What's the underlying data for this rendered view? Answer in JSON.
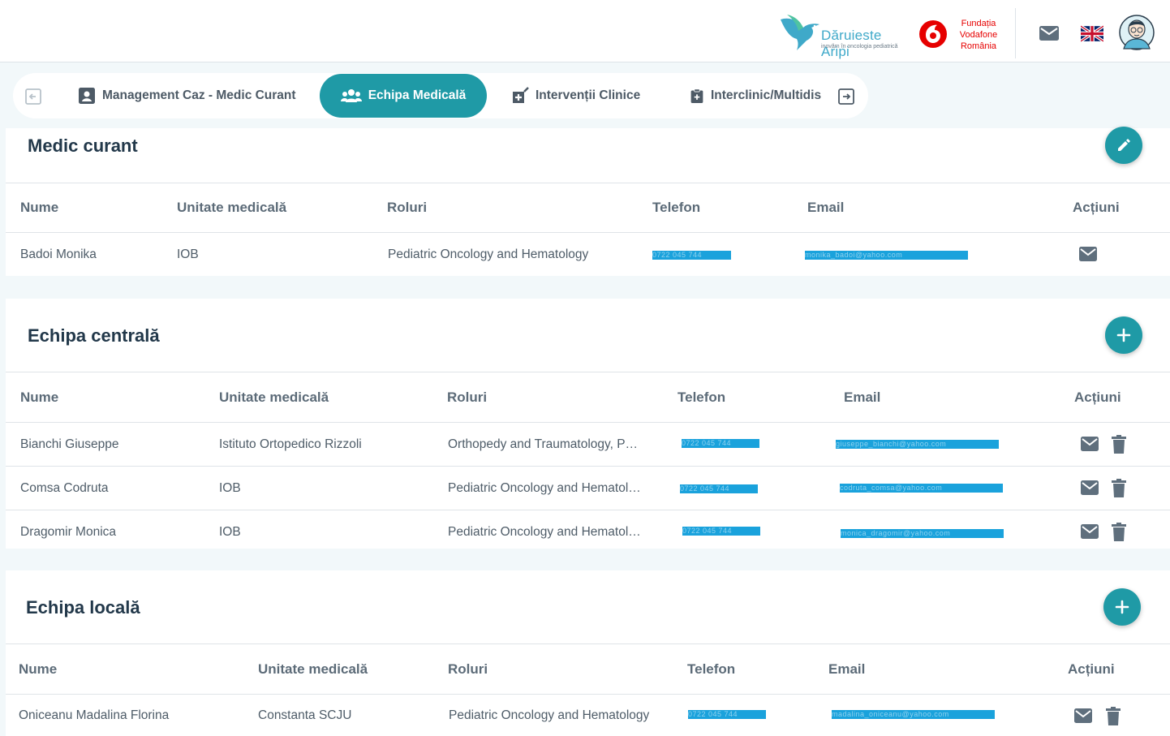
{
  "header": {
    "brand1": {
      "name": "Dăruieste Aripi",
      "tagline": "inovăm în oncologia pediatrică"
    },
    "brand2": {
      "name": "Fundația Vodafone România",
      "line1": "Fundația",
      "line2": "Vodafone",
      "line3": "România"
    },
    "icons": {
      "mail": "mail-icon",
      "language": "uk-flag-icon",
      "avatar": "user-avatar"
    }
  },
  "tabs": [
    {
      "label": "Management Caz - Medic Curant",
      "icon": "id-badge-icon",
      "active": false
    },
    {
      "label": "Echipa Medicală",
      "icon": "users-icon",
      "active": true
    },
    {
      "label": "Intervenții Clinice",
      "icon": "medical-kit-icon",
      "active": false
    },
    {
      "label": "Interclinic/Multidis",
      "icon": "clipboard-icon",
      "active": false
    }
  ],
  "sections": {
    "medic_curant": {
      "title": "Medic curant",
      "fab_icon": "pencil-icon",
      "headers": [
        "Nume",
        "Unitate medicală",
        "Roluri",
        "Telefon",
        "Email",
        "Acțiuni"
      ],
      "rows": [
        {
          "name": "Badoi Monika",
          "unit": "IOB",
          "roles": "Pediatric Oncology and Hematology",
          "phone": "0722 045 744",
          "email": "monika_badoi@yahoo.com"
        }
      ]
    },
    "echipa_centrala": {
      "title": "Echipa centrală",
      "fab_icon": "plus-icon",
      "headers": [
        "Nume",
        "Unitate medicală",
        "Roluri",
        "Telefon",
        "Email",
        "Acțiuni"
      ],
      "rows": [
        {
          "name": "Bianchi Giuseppe",
          "unit": "Istituto Ortopedico Rizzoli",
          "roles": "Orthopedy and Traumatology, P…",
          "phone": "0722 045 744",
          "email": "giuseppe_bianchi@yahoo.com"
        },
        {
          "name": "Comsa Codruta",
          "unit": "IOB",
          "roles": "Pediatric Oncology and Hematol…",
          "phone": "0722 045 744",
          "email": "codruta_comsa@yahoo.com"
        },
        {
          "name": "Dragomir Monica",
          "unit": "IOB",
          "roles": "Pediatric Oncology and Hematol…",
          "phone": "0722 045 744",
          "email": "monica_dragomir@yahoo.com"
        }
      ]
    },
    "echipa_locala": {
      "title": "Echipa locală",
      "fab_icon": "plus-icon",
      "headers": [
        "Nume",
        "Unitate medicală",
        "Roluri",
        "Telefon",
        "Email",
        "Acțiuni"
      ],
      "rows": [
        {
          "name": "Oniceanu Madalina Florina",
          "unit": "Constanta SCJU",
          "roles": "Pediatric Oncology and Hematology",
          "phone": "0722 045 744",
          "email": "madalina_oniceanu@yahoo.com"
        }
      ]
    }
  },
  "colors": {
    "accent": "#1f9aa6",
    "redaction": "#1aa2dc",
    "background": "#f2f8fa",
    "vodafone_red": "#e60000"
  }
}
